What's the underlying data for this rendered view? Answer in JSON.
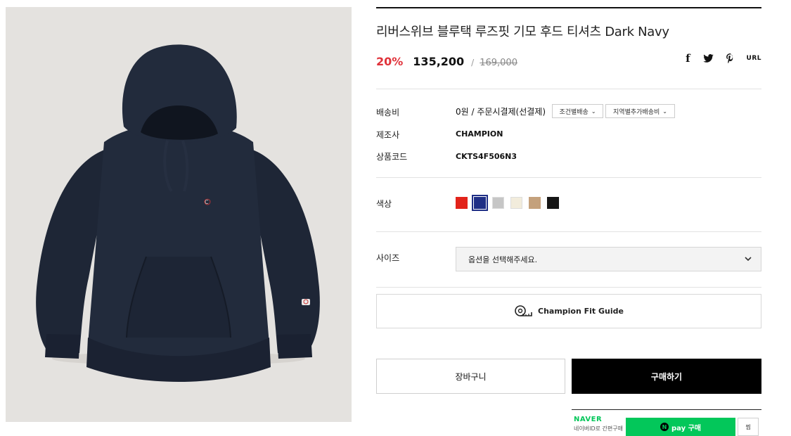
{
  "product": {
    "title": "리버스위브 블루택 루즈핏 기모 후드 티셔츠 Dark Navy",
    "discount": "20%",
    "price": "135,200",
    "price_separator": "/",
    "original_price": "169,000"
  },
  "share": {
    "facebook_icon": "f",
    "url_label": "URL"
  },
  "details": {
    "shipping_label": "배송비",
    "shipping_value": "0원  / 주문시결제(선결제)",
    "shipping_btn1": "조건별배송",
    "shipping_btn2": "지역별추가배송비",
    "maker_label": "제조사",
    "maker_value": "CHAMPION",
    "code_label": "상품코드",
    "code_value": "CKTS4F506N3"
  },
  "options": {
    "color_label": "색상",
    "colors": [
      "#e2231a",
      "#1f2f86",
      "#c6c6c6",
      "#f2ecdc",
      "#c4a17c",
      "#161616"
    ],
    "selected_color_index": 1,
    "size_label": "사이즈",
    "size_placeholder": "옵션을 선택해주세요."
  },
  "fit_guide": {
    "label": "Champion Fit Guide"
  },
  "actions": {
    "cart": "장바구니",
    "buy": "구매하기"
  },
  "naver": {
    "logo": "NAVER",
    "subtext": "네이버ID로 간편구매",
    "pay_mark": "N",
    "pay_label": "pay 구매",
    "wishlist": "찜"
  },
  "colors": {
    "discount": "#e0323a",
    "buy_bg": "#000000",
    "naver_green": "#03c75a",
    "image_bg": "#e4e2df"
  }
}
